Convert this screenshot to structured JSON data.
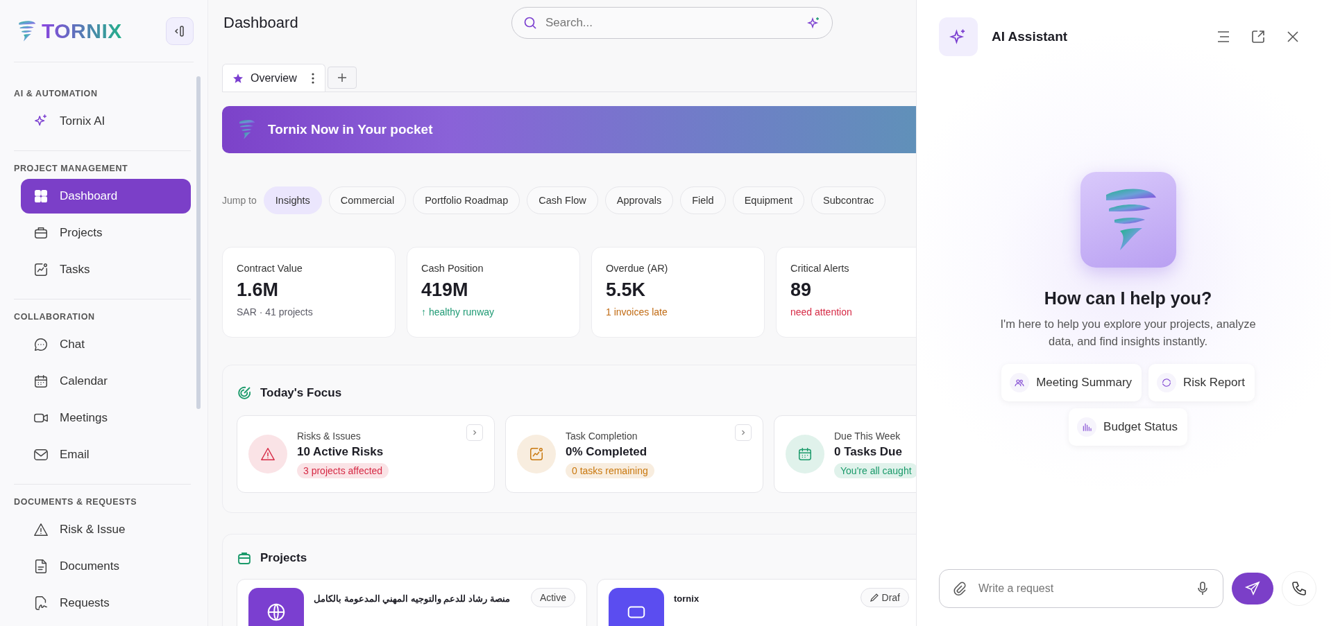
{
  "sidebar": {
    "logo": "TORNIX",
    "sections": [
      {
        "title": "AI & AUTOMATION",
        "items": [
          {
            "label": "Tornix AI",
            "selected": false
          }
        ]
      },
      {
        "title": "PROJECT MANAGEMENT",
        "items": [
          {
            "label": "Dashboard",
            "selected": true
          },
          {
            "label": "Projects",
            "selected": false
          },
          {
            "label": "Tasks",
            "selected": false
          }
        ]
      },
      {
        "title": "COLLABORATION",
        "items": [
          {
            "label": "Chat",
            "selected": false
          },
          {
            "label": "Calendar",
            "selected": false
          },
          {
            "label": "Meetings",
            "selected": false
          },
          {
            "label": "Email",
            "selected": false
          }
        ]
      },
      {
        "title": "DOCUMENTS & REQUESTS",
        "items": [
          {
            "label": "Risk & Issue",
            "selected": false
          },
          {
            "label": "Documents",
            "selected": false
          },
          {
            "label": "Requests",
            "selected": false
          }
        ]
      }
    ]
  },
  "header": {
    "title": "Dashboard",
    "search": {
      "placeholder": "Search..."
    }
  },
  "tabs": [
    {
      "label": "Overview",
      "selected": true
    }
  ],
  "banner": {
    "text": "Tornix Now in Your pocket"
  },
  "jump": {
    "label": "Jump to",
    "chips": [
      {
        "label": "Insights",
        "selected": true
      },
      {
        "label": "Commercial",
        "selected": false
      },
      {
        "label": "Portfolio Roadmap",
        "selected": false
      },
      {
        "label": "Cash Flow",
        "selected": false
      },
      {
        "label": "Approvals",
        "selected": false
      },
      {
        "label": "Field",
        "selected": false
      },
      {
        "label": "Equipment",
        "selected": false
      },
      {
        "label": "Subcontrac",
        "selected": false
      }
    ]
  },
  "kpis": [
    {
      "label": "Contract Value",
      "value": "1.6M",
      "note": "SAR · 41 projects",
      "color": "#5b5b66"
    },
    {
      "label": "Cash Position",
      "value": "419M",
      "note": "↑ healthy runway",
      "color": "#1f9a74"
    },
    {
      "label": "Overdue (AR)",
      "value": "5.5K",
      "note": "1 invoices late",
      "color": "#c06a12"
    },
    {
      "label": "Critical Alerts",
      "value": "89",
      "note": "need attention",
      "color": "#d62a45"
    }
  ],
  "focus": {
    "title": "Today's Focus",
    "cards": [
      {
        "kind": "risk",
        "label": "Risks & Issues",
        "value": "10 Active Risks",
        "badge": "3 projects affected",
        "color": "#d62a45"
      },
      {
        "kind": "tasks",
        "label": "Task Completion",
        "value": "0% Completed",
        "badge": "0 tasks remaining",
        "color": "#c9780e"
      },
      {
        "kind": "due",
        "label": "Due This Week",
        "value": "0 Tasks Due",
        "badge": "You're all caught",
        "color": "#1a9a6a"
      }
    ]
  },
  "projects": {
    "title": "Projects",
    "items": [
      {
        "title": "منصة رشاد للدعم والتوجيه المهني المدعومة بالكامل",
        "status": "Active",
        "color": "#7b3fd0"
      },
      {
        "title": "tornix",
        "action": "Draf",
        "color": "#5b4df0"
      }
    ]
  },
  "assistant": {
    "title": "AI Assistant",
    "heading": "How can I help you?",
    "description": "I'm here to help you explore your projects, analyze data, and find insights instantly.",
    "suggestions": [
      {
        "label": "Meeting Summary"
      },
      {
        "label": "Risk Report"
      },
      {
        "label": "Budget Status"
      }
    ],
    "input": {
      "placeholder": "Write a request"
    }
  }
}
